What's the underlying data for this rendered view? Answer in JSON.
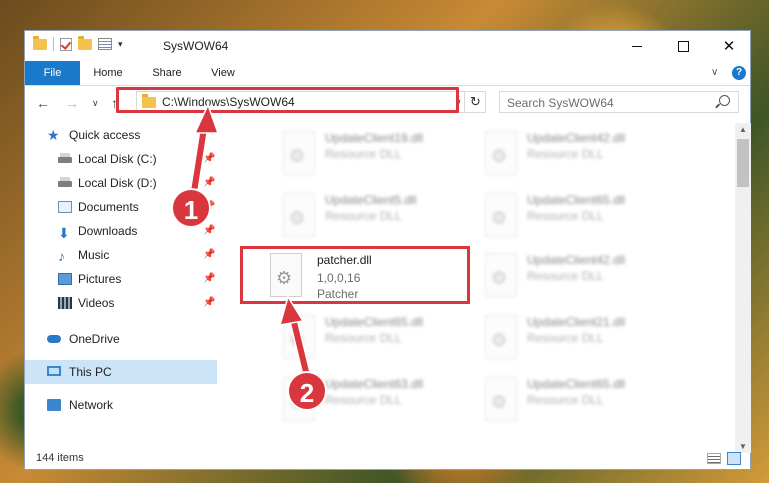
{
  "window": {
    "title": "SysWOW64",
    "minimize_glyph": "",
    "close_glyph": "✕"
  },
  "ribbon": {
    "tabs": [
      "File",
      "Home",
      "Share",
      "View"
    ],
    "expand_glyph": "∨",
    "help_glyph": "?"
  },
  "nav": {
    "back_glyph": "←",
    "forward_glyph": "→",
    "recent_glyph": "∨",
    "up_glyph": "↑"
  },
  "address": {
    "path": "C:\\Windows\\SysWOW64",
    "dropdown_glyph": "∨",
    "refresh_glyph": "↻"
  },
  "search": {
    "placeholder": "Search SysWOW64"
  },
  "sidebar": {
    "items": [
      {
        "label": "Quick access",
        "icon": "star-icon"
      },
      {
        "label": "Local Disk (C:)",
        "icon": "drive-icon",
        "pinned": true
      },
      {
        "label": "Local Disk (D:)",
        "icon": "drive-icon",
        "pinned": true
      },
      {
        "label": "Documents",
        "icon": "documents-icon",
        "pinned": true
      },
      {
        "label": "Downloads",
        "icon": "downloads-icon",
        "pinned": true
      },
      {
        "label": "Music",
        "icon": "music-icon",
        "pinned": true
      },
      {
        "label": "Pictures",
        "icon": "pictures-icon",
        "pinned": true
      },
      {
        "label": "Videos",
        "icon": "videos-icon",
        "pinned": true
      },
      {
        "label": "OneDrive",
        "icon": "onedrive-icon"
      },
      {
        "label": "This PC",
        "icon": "this-pc-icon",
        "selected": true
      },
      {
        "label": "Network",
        "icon": "network-icon"
      }
    ]
  },
  "files": [
    {
      "name": "UpdateClient19.dll",
      "line2": "Resource DLL"
    },
    {
      "name": "UpdateClient42.dll",
      "line2": "Resource DLL"
    },
    {
      "name": "UpdateClient5.dll",
      "line2": "Resource DLL"
    },
    {
      "name": "UpdateClient65.dll",
      "line2": "Resource DLL"
    },
    {
      "name": "patcher.dll",
      "line2": "1,0,0,16",
      "line3": "Patcher",
      "highlighted": true
    },
    {
      "name": "UpdateClient42.dll",
      "line2": "Resource DLL"
    },
    {
      "name": "UpdateClient65.dll",
      "line2": "Resource DLL"
    },
    {
      "name": "UpdateClient21.dll",
      "line2": "Resource DLL"
    },
    {
      "name": "UpdateClient63.dll",
      "line2": "Resource DLL"
    },
    {
      "name": "UpdateClient65.dll",
      "line2": "Resource DLL"
    }
  ],
  "status": {
    "item_count": "144 items"
  },
  "annotations": {
    "step1": "1",
    "step2": "2",
    "color": "#d9363e"
  },
  "colors": {
    "accent": "#1979ca",
    "selection": "#cce4f7"
  }
}
